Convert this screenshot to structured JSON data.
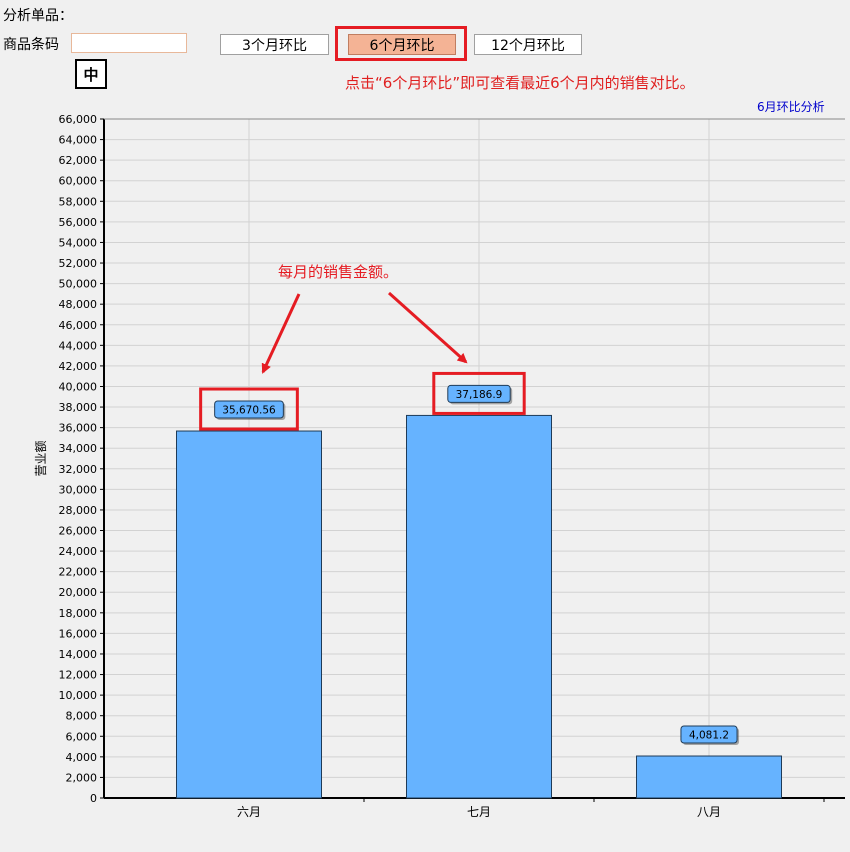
{
  "header": {
    "section_title": "分析单品：",
    "barcode_label": "商品条码",
    "barcode_value": "",
    "ime_indicator": "中"
  },
  "range_buttons": [
    {
      "label": "3个月环比",
      "selected": false
    },
    {
      "label": "6个月环比",
      "selected": true
    },
    {
      "label": "12个月环比",
      "selected": false
    }
  ],
  "annotations": {
    "hint": "点击“6个月环比”即可查看最近6个月内的销售对比。",
    "monthly_note": "每月的销售金额。"
  },
  "chart_link": "6月环比分析",
  "colors": {
    "bar_fill": "#66b3ff",
    "bar_stroke": "#1f3b57",
    "annotation_red": "#e51c23",
    "selected_button": "#f4b395"
  },
  "chart_data": {
    "type": "bar",
    "categories": [
      "六月",
      "七月",
      "八月"
    ],
    "values": [
      35670.56,
      37186.9,
      4081.2
    ],
    "data_labels": [
      "35,670.56",
      "37,186.9",
      "4,081.2"
    ],
    "ylabel": "营业额",
    "ylim": [
      0,
      66000
    ],
    "ytick_step": 2000,
    "grid": true
  }
}
